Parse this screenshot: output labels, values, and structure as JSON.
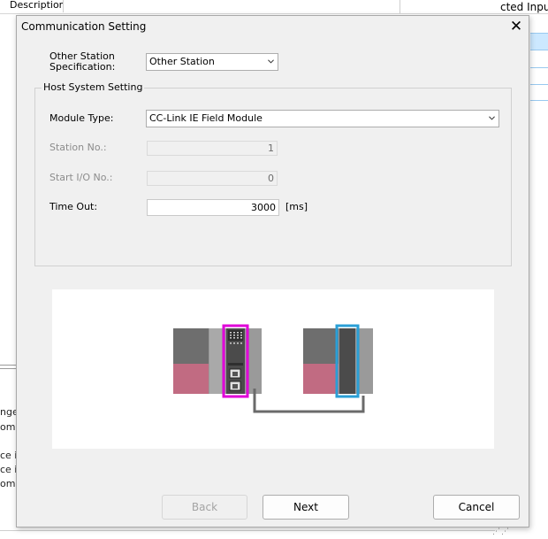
{
  "background": {
    "description_header": "Description",
    "right_header": "cted Input",
    "left_texts": [
      "nge",
      "omp",
      "ce is",
      "ce is",
      "omp"
    ]
  },
  "dialog": {
    "title": "Communication Setting",
    "close_icon": "close-icon",
    "other_station_label": "Other Station\nSpecification:",
    "other_station_value": "Other Station",
    "host_group_title": "Host System Setting",
    "module_type_label": "Module Type:",
    "module_type_value": "CC-Link IE Field Module",
    "station_no_label": "Station No.:",
    "station_no_value": "1",
    "start_io_label": "Start I/O No.:",
    "start_io_value": "0",
    "timeout_label": "Time Out:",
    "timeout_value": "3000",
    "timeout_unit": "[ms]",
    "buttons": {
      "back": "Back",
      "next": "Next",
      "cancel": "Cancel"
    }
  },
  "colors": {
    "host_highlight": "#e000d8",
    "other_highlight": "#2a9fd6",
    "power_unit": "#c16b82",
    "unit_dark": "#6e6e6e"
  }
}
